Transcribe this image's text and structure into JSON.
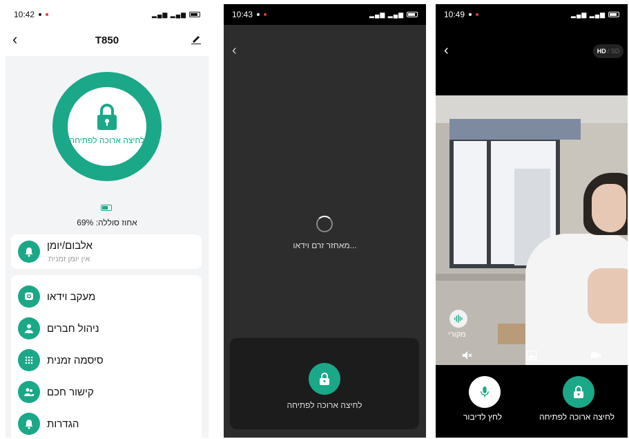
{
  "screen1": {
    "status": {
      "time": "10:42"
    },
    "title": "T850",
    "lock_label": "לחיצה ארוכה לפתיחה",
    "battery_text": "אחוז סוללה: 69%",
    "battery_level": 0.69,
    "album": {
      "label": "אלבום/יומן",
      "sub": "אין יומן זמנית"
    },
    "menu": [
      {
        "label": "מעקב וידאו",
        "icon": "camera-icon"
      },
      {
        "label": "ניהול חברים",
        "icon": "person-icon"
      },
      {
        "label": "סיסמה זמנית",
        "icon": "keypad-icon"
      },
      {
        "label": "קישור חכם",
        "icon": "people-icon"
      },
      {
        "label": "הגדרות",
        "icon": "bell-icon"
      }
    ]
  },
  "screen2": {
    "status": {
      "time": "10:43"
    },
    "loading_text": "מאחזר זרם וידאו...",
    "unlock_label": "לחיצה ארוכה לפתיחה"
  },
  "screen3": {
    "status": {
      "time": "10:49"
    },
    "quality": {
      "hd": "HD",
      "sd": "SD"
    },
    "voice_label": "מקורי",
    "talk_label": "לחץ לדיבור",
    "unlock_label": "לחיצה ארוכה לפתיחה"
  },
  "colors": {
    "accent": "#1aa888"
  }
}
